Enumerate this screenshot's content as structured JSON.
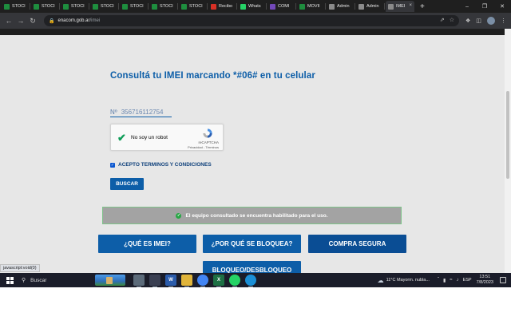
{
  "browser": {
    "tabs": [
      {
        "label": "STOCI",
        "icon": "green-sheet-icon",
        "color": "#1e8e3e"
      },
      {
        "label": "STOCI",
        "icon": "green-sheet-icon",
        "color": "#1e8e3e"
      },
      {
        "label": "STOCI",
        "icon": "green-sheet-icon",
        "color": "#1e8e3e"
      },
      {
        "label": "STOCI",
        "icon": "green-sheet-icon",
        "color": "#1e8e3e"
      },
      {
        "label": "STOCI",
        "icon": "green-sheet-icon",
        "color": "#1e8e3e"
      },
      {
        "label": "STOCI",
        "icon": "green-sheet-icon",
        "color": "#1e8e3e"
      },
      {
        "label": "STOCI",
        "icon": "green-sheet-icon",
        "color": "#1e8e3e"
      },
      {
        "label": "Recibo",
        "icon": "gmail-icon",
        "color": "#d93025"
      },
      {
        "label": "Whats",
        "icon": "whatsapp-icon",
        "color": "#25d366"
      },
      {
        "label": "COMI",
        "icon": "purple-form-icon",
        "color": "#7248b9"
      },
      {
        "label": "MOVII",
        "icon": "green-sheet-icon",
        "color": "#1e8e3e"
      },
      {
        "label": "Admin",
        "icon": "globe-icon",
        "color": "#8a8a8a"
      },
      {
        "label": "Admin",
        "icon": "globe-icon",
        "color": "#8a8a8a"
      },
      {
        "label": "IMEI",
        "icon": "globe-icon",
        "color": "#8a8a8a",
        "active": true
      }
    ],
    "new_tab": "+",
    "url_host": "enacom.gob.ar",
    "url_path": "/imei"
  },
  "page": {
    "heading": "Consultá tu IMEI marcando *#06# en tu celular",
    "imei_prefix": "Nº",
    "imei_value": "356716112754",
    "captcha": {
      "label": "No soy un robot",
      "brand": "reCAPTCHA",
      "links": "Privacidad - Términos"
    },
    "terms_label": "ACEPTO TERMINOS Y CONDICIONES",
    "search_button": "BUSCAR",
    "result_message": "El equipo consultado se encuentra habilitado para el uso.",
    "buttons": {
      "que_es_imei": "¿QUÉ ES IMEI?",
      "por_que_se_bloquea": "¿POR QUÉ SE BLOQUEA?",
      "compra_segura": "COMPRA SEGURA",
      "bloqueo_desbloqueo": "BLOQUEO/DESBLOQUEO"
    },
    "status_link": "javascript:void(0)",
    "accent_color": "#0d5ea8"
  },
  "taskbar": {
    "search_placeholder": "Buscar",
    "apps": [
      {
        "icon": "calculator-icon",
        "text": ""
      },
      {
        "icon": "task-view-icon",
        "text": ""
      },
      {
        "icon": "word-icon",
        "text": "W"
      },
      {
        "icon": "file-explorer-icon",
        "text": ""
      },
      {
        "icon": "chrome-icon",
        "text": ""
      },
      {
        "icon": "excel-icon",
        "text": "X"
      },
      {
        "icon": "whatsapp-icon",
        "text": ""
      },
      {
        "icon": "edge-icon",
        "text": ""
      }
    ],
    "weather": "11°C  Mayorm. nubla...",
    "language": "ESP",
    "time": "13:51",
    "date": "7/8/2023"
  }
}
